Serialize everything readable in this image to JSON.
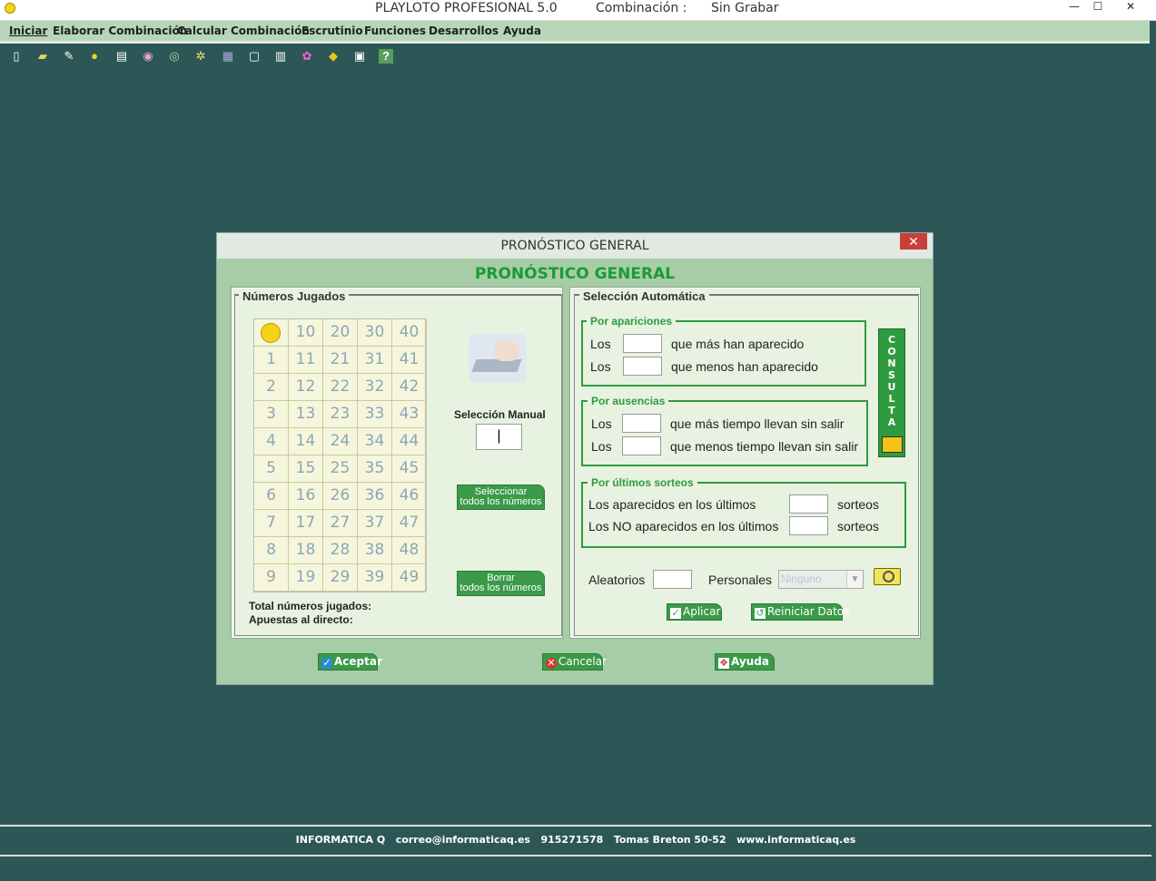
{
  "window": {
    "app_title": "PLAYLOTO PROFESIONAL 5.0",
    "combination_label": "Combinación :",
    "combination_value": "Sin Grabar",
    "minimize": "—",
    "maximize": "☐",
    "close": "✕"
  },
  "menu": [
    {
      "label": "Iniciar"
    },
    {
      "label": "Elaborar Combinación"
    },
    {
      "label": "Calcular Combinación"
    },
    {
      "label": "Escrutinio"
    },
    {
      "label": "Funciones"
    },
    {
      "label": "Desarrollos"
    },
    {
      "label": "Ayuda"
    }
  ],
  "toolbar": [
    {
      "icon": "new-file-icon",
      "glyph": "▯"
    },
    {
      "icon": "open-folder-icon",
      "glyph": "▰"
    },
    {
      "icon": "edit-icon",
      "glyph": "✎"
    },
    {
      "icon": "smiley-icon",
      "glyph": "●"
    },
    {
      "icon": "document-icon",
      "glyph": "▤"
    },
    {
      "icon": "user-search-icon",
      "glyph": "◉"
    },
    {
      "icon": "globe-search-icon",
      "glyph": "◎"
    },
    {
      "icon": "settings-icon",
      "glyph": "✲"
    },
    {
      "icon": "calculator-icon",
      "glyph": "▦"
    },
    {
      "icon": "preview-icon",
      "glyph": "▢"
    },
    {
      "icon": "print-icon",
      "glyph": "▥"
    },
    {
      "icon": "flower-icon",
      "glyph": "✿"
    },
    {
      "icon": "badge-icon",
      "glyph": "◆"
    },
    {
      "icon": "exit-icon",
      "glyph": "▣"
    },
    {
      "icon": "help-icon",
      "glyph": "?"
    }
  ],
  "status_bar": {
    "text": "INFORMATICA Q   correo@informaticaq.es   915271578   Tomas Breton 50-52   www.informaticaq.es"
  },
  "dialog": {
    "title": "PRONÓSTICO GENERAL",
    "heading": "PRONÓSTICO GENERAL",
    "close": "✕",
    "numeros_jugados": {
      "group_label": "Números Jugados",
      "grid_columns": [
        [
          "",
          "1",
          "2",
          "3",
          "4",
          "5",
          "6",
          "7",
          "8",
          "9"
        ],
        [
          "10",
          "11",
          "12",
          "13",
          "14",
          "15",
          "16",
          "17",
          "18",
          "19"
        ],
        [
          "20",
          "21",
          "22",
          "23",
          "24",
          "25",
          "26",
          "27",
          "28",
          "29"
        ],
        [
          "30",
          "31",
          "32",
          "33",
          "34",
          "35",
          "36",
          "37",
          "38",
          "39"
        ],
        [
          "40",
          "41",
          "42",
          "43",
          "44",
          "45",
          "46",
          "47",
          "48",
          "49"
        ]
      ],
      "seleccion_manual_label": "Selección Manual",
      "seleccion_manual_value": "|",
      "select_all_line1": "Seleccionar",
      "select_all_line2": "todos los números",
      "clear_all_line1": "Borrar",
      "clear_all_line2": "todos los números",
      "total_label": "Total números jugados:",
      "apuestas_label": "Apuestas al directo:"
    },
    "seleccion_automatica": {
      "group_label": "Selección Automática",
      "por_apariciones": {
        "label": "Por apariciones",
        "row1_prefix": "Los",
        "row1_suffix": "que más han aparecido",
        "row2_prefix": "Los",
        "row2_suffix": "que menos han aparecido"
      },
      "por_ausencias": {
        "label": "Por ausencias",
        "row1_prefix": "Los",
        "row1_suffix": "que más tiempo llevan sin salir",
        "row2_prefix": "Los",
        "row2_suffix": "que menos tiempo llevan sin salir"
      },
      "por_ultimos": {
        "label": "Por últimos sorteos",
        "row1_prefix": "Los aparecidos en los últimos",
        "row1_suffix": "sorteos",
        "row2_prefix": "Los NO aparecidos en los últimos",
        "row2_suffix": "sorteos"
      },
      "consulta_letters": [
        "C",
        "O",
        "N",
        "S",
        "U",
        "L",
        "T",
        "A"
      ],
      "aleatorios_label": "Aleatorios",
      "personales_label": "Personales",
      "personales_value": "Ninguno",
      "aplicar": "Aplicar",
      "reiniciar": "Reiniciar Datos"
    },
    "aceptar": "Aceptar",
    "cancelar": "Cancelar",
    "ayuda": "Ayuda"
  }
}
